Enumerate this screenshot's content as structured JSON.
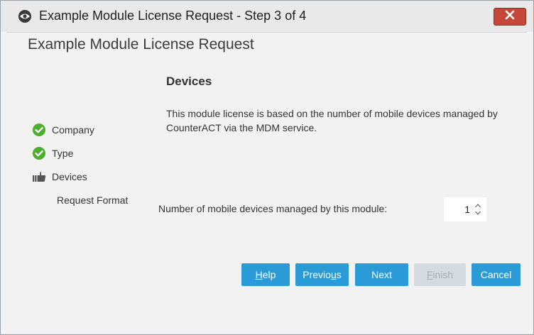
{
  "window": {
    "title": "Example Module License Request - Step 3 of 4",
    "app_icon": "eye-icon",
    "close_icon": "close-icon"
  },
  "page_title": "Example Module License Request",
  "steps": [
    {
      "label": "Company",
      "status": "complete",
      "icon": "check-circle-icon"
    },
    {
      "label": "Type",
      "status": "complete",
      "icon": "check-circle-icon"
    },
    {
      "label": "Devices",
      "status": "current",
      "icon": "thumbs-up-icon"
    },
    {
      "label": "Request Format",
      "status": "pending"
    }
  ],
  "section": {
    "title": "Devices",
    "description": "This module license is based on the number of mobile devices managed by CounterACT via the MDM service."
  },
  "device_count": {
    "label": "Number of mobile devices managed by this module:",
    "value": "1"
  },
  "buttons": {
    "help": {
      "pre": "",
      "mnemonic": "H",
      "post": "elp",
      "enabled": true
    },
    "previous": {
      "pre": "Previo",
      "mnemonic": "u",
      "post": "s",
      "enabled": true
    },
    "next": {
      "label": "Next",
      "enabled": true
    },
    "finish": {
      "pre": "",
      "mnemonic": "F",
      "post": "inish",
      "enabled": false
    },
    "cancel": {
      "label": "Cancel",
      "enabled": true
    }
  },
  "colors": {
    "accent": "#2b9bd7",
    "success": "#4caf2e",
    "close": "#c7463a"
  }
}
